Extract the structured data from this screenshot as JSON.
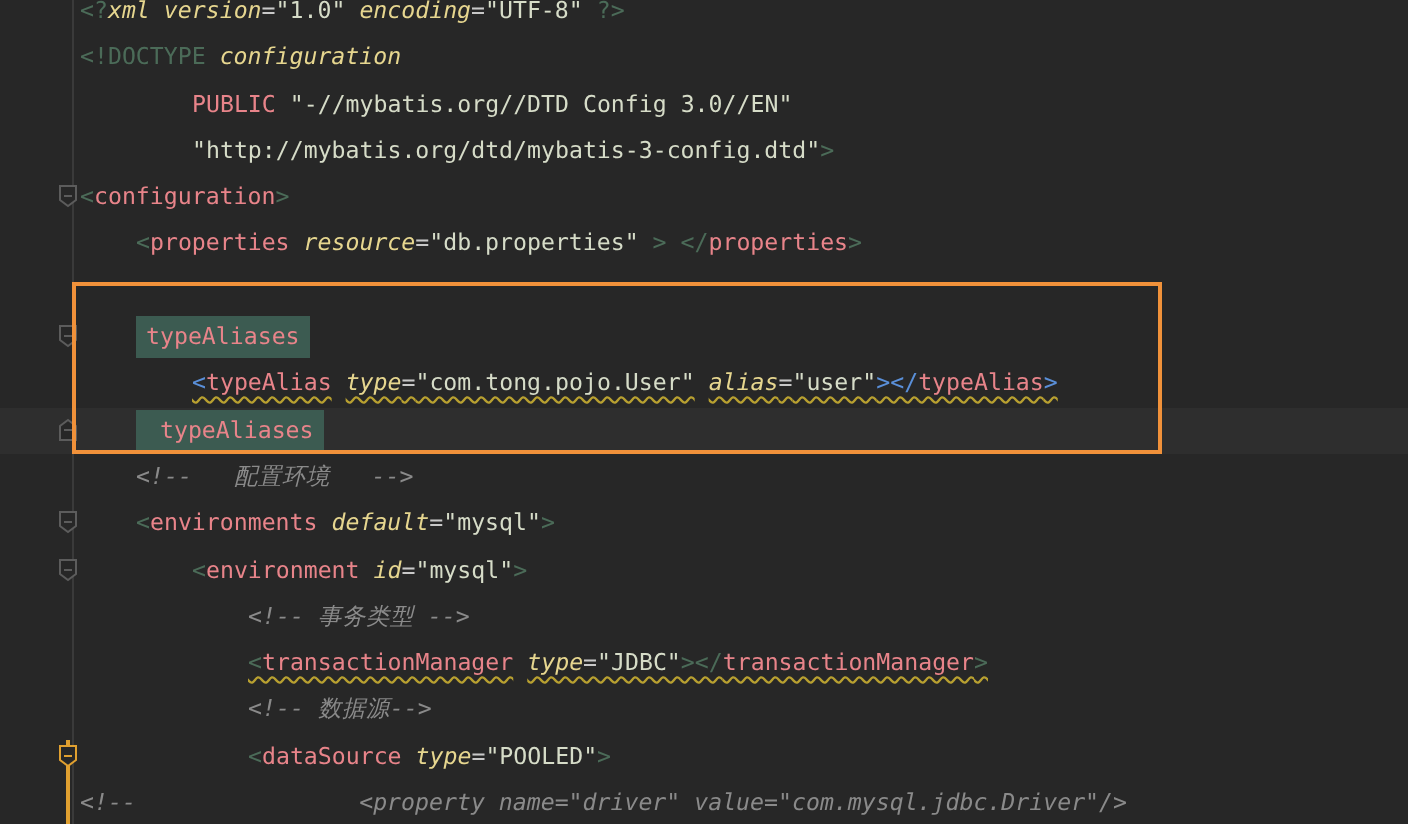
{
  "lines": [
    {
      "tokens": [
        {
          "kind": "bracket",
          "text": "<?"
        },
        {
          "kind": "attr",
          "text": "xml"
        },
        {
          "kind": "attr",
          "text": "version"
        },
        {
          "kind": "punct",
          "text": "="
        },
        {
          "kind": "value",
          "text": "\"1.0\""
        },
        {
          "kind": "attr",
          "text": "encoding"
        },
        {
          "kind": "punct",
          "text": "="
        },
        {
          "kind": "value",
          "text": "\"UTF-8\""
        },
        {
          "kind": "bracket",
          "text": " ?>"
        }
      ]
    },
    {
      "tokens": [
        {
          "kind": "doctype",
          "text": "<!DOCTYPE"
        },
        {
          "kind": "attr",
          "text": "configuration"
        }
      ],
      "children": [
        {
          "kind": "continuation",
          "tokens": [
            {
              "kind": "keyword",
              "text": "PUBLIC"
            },
            {
              "kind": "value",
              "text": "\"-//mybatis.org//DTD Config 3.0//EN\""
            }
          ]
        },
        {
          "kind": "continuation",
          "tokens": [
            {
              "kind": "value",
              "text": "\"http://mybatis.org/dtd/mybatis-3-config.dtd\""
            },
            {
              "kind": "bracket",
              "text": ">"
            }
          ]
        }
      ]
    },
    {
      "fold": true,
      "tokens": [
        {
          "kind": "bracket",
          "text": "<"
        },
        {
          "kind": "tag",
          "text": "configuration"
        },
        {
          "kind": "bracket",
          "text": ">"
        }
      ],
      "children": [
        {
          "tokens": [
            {
              "kind": "bracket",
              "text": "<"
            },
            {
              "kind": "tag",
              "text": "properties"
            },
            {
              "kind": "attr",
              "text": "resource"
            },
            {
              "kind": "punct",
              "text": "="
            },
            {
              "kind": "value",
              "text": "\"db.properties\""
            },
            {
              "kind": "bracket",
              "text": " > </"
            },
            {
              "kind": "tag",
              "text": "properties"
            },
            {
              "kind": "bracket",
              "text": ">"
            }
          ]
        },
        {
          "kind": "blank"
        },
        {
          "fold": true,
          "tokens": [
            {
              "kind": "match",
              "text": "typeAliases"
            }
          ],
          "children": [
            {
              "warning": true,
              "tokens": [
                {
                  "kind": "brace",
                  "text": "<"
                },
                {
                  "kind": "tag",
                  "text": "typeAlias"
                },
                {
                  "kind": "attr",
                  "text": "type"
                },
                {
                  "kind": "punct",
                  "text": "="
                },
                {
                  "kind": "value",
                  "text": "\"com.tong.pojo.User\""
                },
                {
                  "kind": "attr",
                  "text": "alias"
                },
                {
                  "kind": "punct",
                  "text": "="
                },
                {
                  "kind": "value",
                  "text": "\"user\""
                },
                {
                  "kind": "brace",
                  "text": "></"
                },
                {
                  "kind": "tag",
                  "text": "typeAlias"
                },
                {
                  "kind": "brace",
                  "text": ">"
                }
              ]
            }
          ]
        },
        {
          "fold_end": true,
          "current": true,
          "tokens": [
            {
              "kind": "match",
              "text": " typeAliases"
            }
          ]
        },
        {
          "tokens": [
            {
              "kind": "comment",
              "text": "<!--   配置环境   -->"
            }
          ]
        },
        {
          "fold": true,
          "tokens": [
            {
              "kind": "bracket",
              "text": "<"
            },
            {
              "kind": "tag",
              "text": "environments"
            },
            {
              "kind": "attr",
              "text": "default"
            },
            {
              "kind": "punct",
              "text": "="
            },
            {
              "kind": "value",
              "text": "\"mysql\""
            },
            {
              "kind": "bracket",
              "text": ">"
            }
          ],
          "children": [
            {
              "fold": true,
              "tokens": [
                {
                  "kind": "bracket",
                  "text": "<"
                },
                {
                  "kind": "tag",
                  "text": "environment"
                },
                {
                  "kind": "attr",
                  "text": "id"
                },
                {
                  "kind": "punct",
                  "text": "="
                },
                {
                  "kind": "value",
                  "text": "\"mysql\""
                },
                {
                  "kind": "bracket",
                  "text": ">"
                }
              ],
              "children": [
                {
                  "tokens": [
                    {
                      "kind": "comment",
                      "text": "<!-- 事务类型 -->"
                    }
                  ]
                },
                {
                  "warning": true,
                  "tokens": [
                    {
                      "kind": "bracket",
                      "text": "<"
                    },
                    {
                      "kind": "tag",
                      "text": "transactionManager"
                    },
                    {
                      "kind": "attr",
                      "text": "type"
                    },
                    {
                      "kind": "punct",
                      "text": "="
                    },
                    {
                      "kind": "value",
                      "text": "\"JDBC\""
                    },
                    {
                      "kind": "bracket",
                      "text": "></"
                    },
                    {
                      "kind": "tag",
                      "text": "transactionManager"
                    },
                    {
                      "kind": "bracket",
                      "text": ">"
                    }
                  ]
                },
                {
                  "tokens": [
                    {
                      "kind": "comment",
                      "text": "<!-- 数据源-->"
                    }
                  ]
                },
                {
                  "fold": true,
                  "caret_scope": true,
                  "tokens": [
                    {
                      "kind": "bracket",
                      "text": "<"
                    },
                    {
                      "kind": "tag",
                      "text": "dataSource"
                    },
                    {
                      "kind": "attr",
                      "text": "type"
                    },
                    {
                      "kind": "punct",
                      "text": "="
                    },
                    {
                      "kind": "value",
                      "text": "\"POOLED\""
                    },
                    {
                      "kind": "bracket",
                      "text": ">"
                    }
                  ]
                }
              ]
            }
          ]
        }
      ]
    },
    {
      "tokens": [
        {
          "kind": "comment",
          "text": "<!--                <property name=\"driver\" value=\"com.mysql.jdbc.Driver\"/>"
        }
      ]
    }
  ]
}
